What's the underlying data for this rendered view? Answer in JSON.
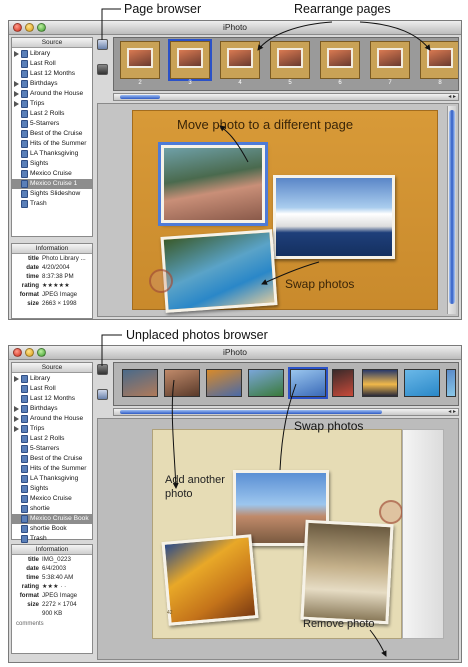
{
  "callouts": {
    "page_browser": "Page browser",
    "rearrange_pages": "Rearrange pages",
    "unplaced_photos_browser": "Unplaced photos browser"
  },
  "app_title": "iPhoto",
  "source_header": "Source",
  "info_header": "Information",
  "top_window": {
    "source_items": [
      "Library",
      "Last Roll",
      "Last 12 Months",
      "Birthdays",
      "Around the House",
      "Trips",
      "Last 2 Rolls",
      "5-Starrers",
      "Best of the Cruise",
      "Hits of the Summer",
      "LA Thanksgiving",
      "Sights",
      "Mexico Cruise",
      "Mexico Cruise 1",
      "Sights Slideshow",
      "Trash"
    ],
    "selected_index": 13,
    "info": [
      {
        "k": "title",
        "v": "Photo Library ..."
      },
      {
        "k": "date",
        "v": "4/20/2004"
      },
      {
        "k": "time",
        "v": "8:37:38 PM"
      },
      {
        "k": "rating",
        "v": "★★★★★"
      },
      {
        "k": "format",
        "v": "JPEG Image"
      },
      {
        "k": "size",
        "v": "2663 × 1998"
      }
    ],
    "page_numbers": [
      "2",
      "3",
      "4",
      "5",
      "6",
      "7",
      "8"
    ],
    "selected_page": 1,
    "page_heading": "Move photo to a different page",
    "swap_label": "Swap photos"
  },
  "bottom_window": {
    "source_items": [
      "Library",
      "Last Roll",
      "Last 12 Months",
      "Birthdays",
      "Around the House",
      "Trips",
      "Last 2 Rolls",
      "5-Starrers",
      "Best of the Cruise",
      "Hits of the Summer",
      "LA Thanksgiving",
      "Sights",
      "Mexico Cruise",
      "shortie",
      "Mexico Cruise Book",
      "shortie Book",
      "Trash"
    ],
    "selected_index": 14,
    "info": [
      {
        "k": "title",
        "v": "IMG_0223"
      },
      {
        "k": "date",
        "v": "6/4/2003"
      },
      {
        "k": "time",
        "v": "5:38:40 AM"
      },
      {
        "k": "rating",
        "v": "★★★ · ·"
      },
      {
        "k": "format",
        "v": "JPEG Image"
      },
      {
        "k": "size",
        "v": "2272 × 1704"
      },
      {
        "k": "",
        "v": "900 KB"
      }
    ],
    "comments": "comments",
    "labels": {
      "swap": "Swap photos",
      "add_another_line1": "Add another",
      "add_another_line2": "photo",
      "remove": "Remove photo"
    },
    "folio": "42"
  }
}
